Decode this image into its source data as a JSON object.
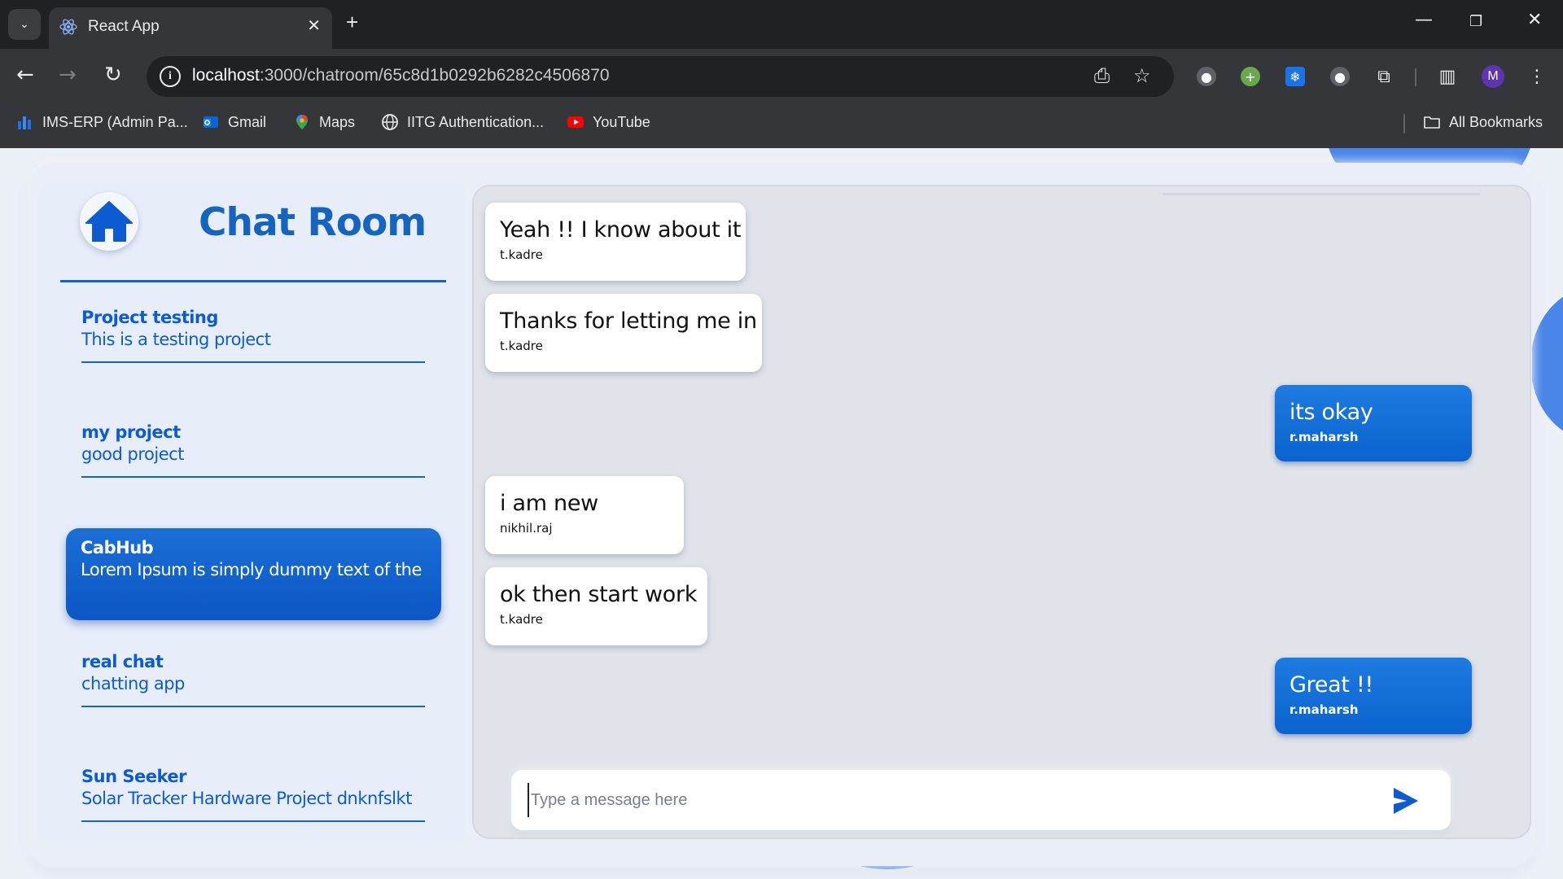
{
  "browser": {
    "tab_title": "React App",
    "url_host": "localhost",
    "url_path": ":3000/chatroom/65c8d1b0292b6282c4506870",
    "profile_initial": "M",
    "bookmarks": [
      {
        "label": "IMS-ERP (Admin Pa...",
        "icon": "bar-chart-icon"
      },
      {
        "label": "Gmail",
        "icon": "outlook-icon"
      },
      {
        "label": "Maps",
        "icon": "maps-pin-icon"
      },
      {
        "label": "IITG Authentication...",
        "icon": "globe-icon"
      },
      {
        "label": "YouTube",
        "icon": "youtube-icon"
      }
    ],
    "all_bookmarks_label": "All Bookmarks"
  },
  "sidebar": {
    "title": "Chat Room",
    "rooms": [
      {
        "name": "Project testing",
        "description": "This is a testing project"
      },
      {
        "name": "my project",
        "description": "good project"
      },
      {
        "name": "CabHub",
        "description": "Lorem Ipsum is simply dummy text of the",
        "active": true
      },
      {
        "name": "real chat",
        "description": "chatting app"
      },
      {
        "name": "Sun Seeker",
        "description": "Solar Tracker Hardware Project dnknfslkt"
      }
    ]
  },
  "messages": [
    {
      "text": "Yeah !! I know about it",
      "user": "t.kadre",
      "side": "incoming"
    },
    {
      "text": "Thanks for letting me in",
      "user": "t.kadre",
      "side": "incoming"
    },
    {
      "text": "its okay",
      "user": "r.maharsh",
      "side": "outgoing"
    },
    {
      "text": "i am new",
      "user": "nikhil.raj",
      "side": "incoming"
    },
    {
      "text": "ok then start work",
      "user": "t.kadre",
      "side": "incoming"
    },
    {
      "text": "Great !!",
      "user": "r.maharsh",
      "side": "outgoing"
    }
  ],
  "composer": {
    "placeholder": "Type a message here",
    "value": ""
  },
  "colors": {
    "accent": "#1565c0",
    "outgoing_bubble": "#0a63cf",
    "incoming_bubble": "#ffffff"
  }
}
